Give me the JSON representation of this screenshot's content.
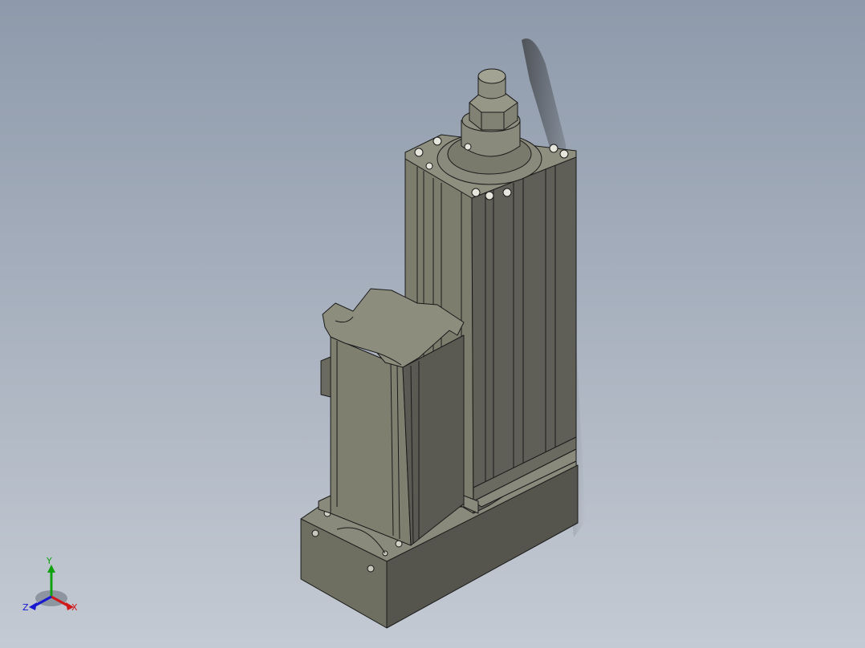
{
  "viewport": {
    "background_top": "#8e9aab",
    "background_bottom": "#c4cad3"
  },
  "model": {
    "body_color": "#7b7b6b",
    "body_light": "#8f8f80",
    "body_dark": "#5a5a52",
    "edge_color": "#1a1a1a"
  },
  "triad": {
    "x_label": "X",
    "y_label": "Y",
    "z_label": "Z",
    "x_color": "#d01818",
    "y_color": "#10a010",
    "z_color": "#1818d0"
  }
}
